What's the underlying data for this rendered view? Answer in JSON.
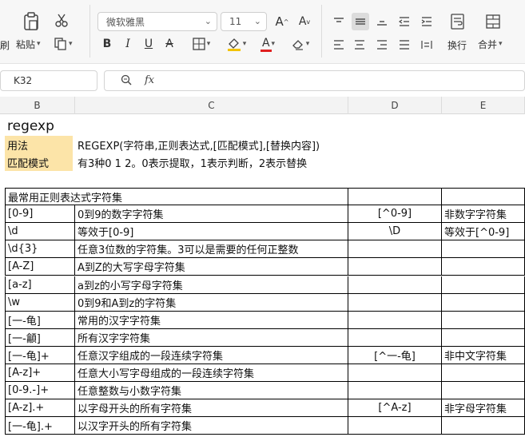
{
  "ribbon": {
    "clipboard": {
      "brush_label": "刷",
      "paste_label": "粘贴",
      "paste_caret": "▾",
      "format_caret": "▾"
    },
    "font": {
      "name": "微软雅黑",
      "size": "11",
      "grow_label": "A",
      "shrink_label": "A",
      "bold": "B",
      "italic": "I",
      "underline": "U",
      "strike": "A",
      "font_color_letter": "A",
      "font_color": "#e02020",
      "highlight_color": "#f2c200"
    },
    "alignment": {
      "wrap_label": "换行",
      "merge_label": "合并",
      "merge_caret": "▾"
    }
  },
  "formula_bar": {
    "cell_ref": "K32",
    "zoom_icon": "zoom-icon",
    "fx_label": "fx",
    "value": ""
  },
  "columns": [
    "B",
    "C",
    "D",
    "E"
  ],
  "sheet": {
    "title": "regexp",
    "usage_label": "用法",
    "usage_text": "REGEXP(字符串,正则表达式,[匹配模式],[替换内容])",
    "mode_label": "匹配模式",
    "mode_text": "有3种0  1  2。0表示提取，1表示判断，2表示替换",
    "table_header": "最常用正则表达式字符集",
    "rows": [
      {
        "pattern": "[0-9]",
        "desc": "0到9的数字字符集",
        "neg": "[^0-9]",
        "neg_desc": "非数字字符集"
      },
      {
        "pattern": "\\d",
        "desc": "等效于[0-9]",
        "neg": "\\D",
        "neg_desc": "等效于[^0-9]"
      },
      {
        "pattern": "\\d{3}",
        "desc": "任意3位数的字符集。3可以是需要的任何正整数",
        "neg": "",
        "neg_desc": ""
      },
      {
        "pattern": "[A-Z]",
        "desc": "A到Z的大写字母字符集",
        "neg": "",
        "neg_desc": ""
      },
      {
        "pattern": "[a-z]",
        "desc": "a到z的小写字母字符集",
        "neg": "",
        "neg_desc": ""
      },
      {
        "pattern": "\\w",
        "desc": "0到9和A到z的字符集",
        "neg": "",
        "neg_desc": ""
      },
      {
        "pattern": "[一-龟]",
        "desc": "常用的汉字字符集",
        "neg": "",
        "neg_desc": ""
      },
      {
        "pattern": "[一-龥]",
        "desc": "所有汉字字符集",
        "neg": "",
        "neg_desc": ""
      },
      {
        "pattern": "[一-龟]+",
        "desc": "任意汉字组成的一段连续字符集",
        "neg": "[^一-龟]",
        "neg_desc": "非中文字符集"
      },
      {
        "pattern": "[A-z]+",
        "desc": "任意大小写字母组成的一段连续字符集",
        "neg": "",
        "neg_desc": ""
      },
      {
        "pattern": "[0-9.-]+",
        "desc": "任意整数与小数字符集",
        "neg": "",
        "neg_desc": ""
      },
      {
        "pattern": "[A-z].+",
        "desc": "以字母开头的所有字符集",
        "neg": "[^A-z]",
        "neg_desc": "非字母字符集"
      },
      {
        "pattern": "[一-龟].+",
        "desc": "以汉字开头的所有字符集",
        "neg": "",
        "neg_desc": ""
      }
    ]
  },
  "colors": {
    "highlight": "#fce4a8",
    "ribbon_bg": "#f7f7f7"
  }
}
